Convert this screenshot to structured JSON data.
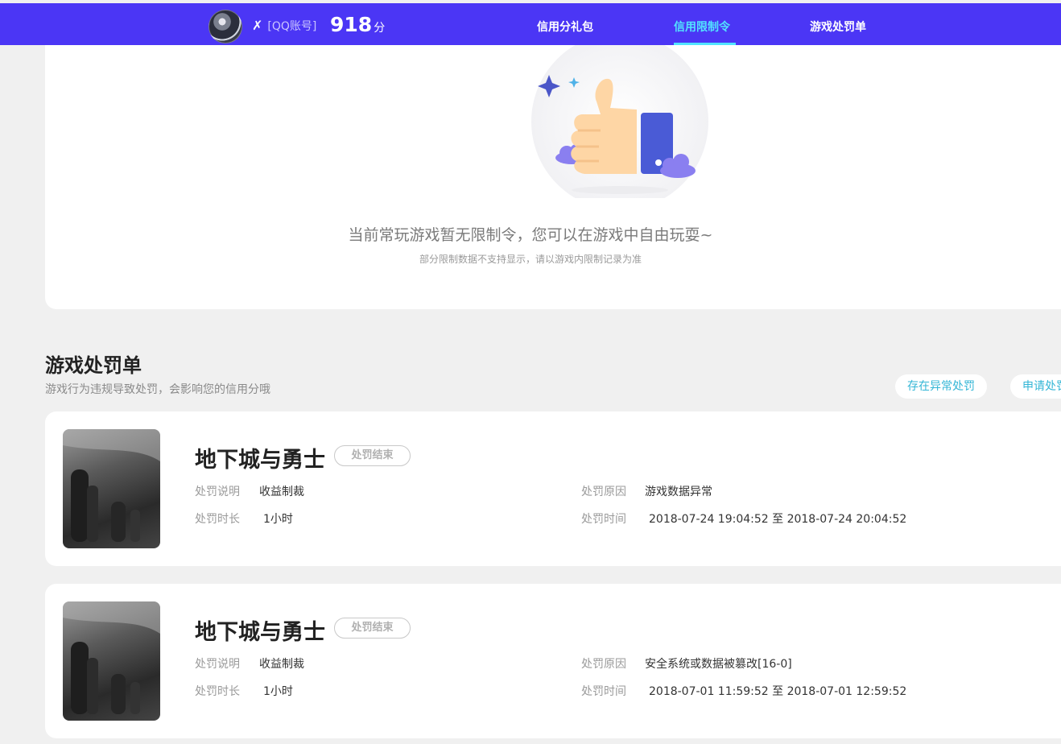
{
  "header": {
    "user_mark": "✗",
    "account_label": "[QQ账号]",
    "score": "918",
    "score_unit": "分",
    "tabs": [
      {
        "label": "信用分礼包",
        "active": false
      },
      {
        "label": "信用限制令",
        "active": true
      },
      {
        "label": "游戏处罚单",
        "active": false
      }
    ]
  },
  "restriction": {
    "empty_title": "当前常玩游戏暂无限制令，您可以在游戏中自由玩耍~",
    "empty_sub": "部分限制数据不支持显示，请以游戏内限制记录为准",
    "illustration_icon": "thumbs-up"
  },
  "penalty_section": {
    "title": "游戏处罚单",
    "subtitle": "游戏行为违规导致处罚，会影响您的信用分哦",
    "buttons": [
      "存在异常处罚",
      "申请处罚"
    ]
  },
  "penalties": [
    {
      "game": "地下城与勇士",
      "status": "处罚结束",
      "desc_label": "处罚说明",
      "desc": "收益制裁",
      "reason_label": "处罚原因",
      "reason": "游戏数据异常",
      "duration_label": "处罚时长",
      "duration": "1小时",
      "time_label": "处罚时间",
      "time": "2018-07-24 19:04:52 至 2018-07-24 20:04:52"
    },
    {
      "game": "地下城与勇士",
      "status": "处罚结束",
      "desc_label": "处罚说明",
      "desc": "收益制裁",
      "reason_label": "处罚原因",
      "reason": "安全系统或数据被篡改[16-0]",
      "duration_label": "处罚时长",
      "duration": "1小时",
      "time_label": "处罚时间",
      "time": "2018-07-01 11:59:52 至 2018-07-01 12:59:52"
    }
  ],
  "colors": {
    "header_bg": "#4b36f5",
    "active_tab": "#52e3ff",
    "page_bg": "#f0f0f0",
    "link": "#33b6d6"
  }
}
